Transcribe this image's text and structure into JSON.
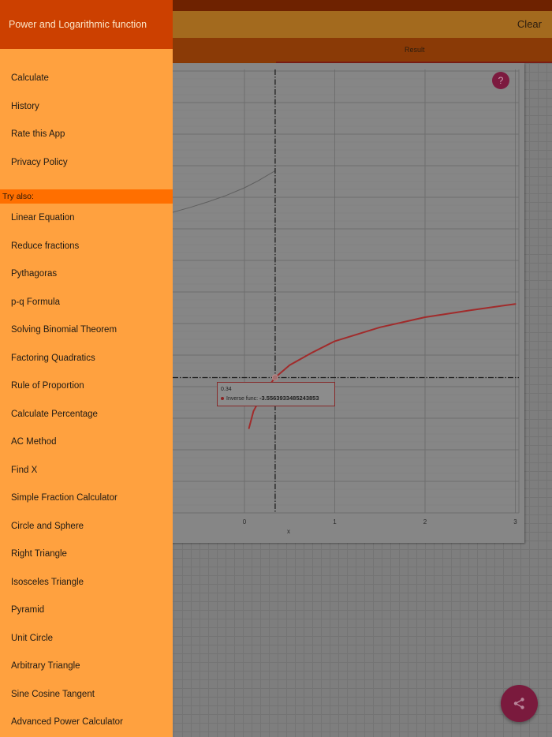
{
  "app": {
    "title": "Power and Logarithmic function",
    "clear_label": "Clear",
    "result_tab": "Result",
    "help_label": "?"
  },
  "drawer": {
    "items": [
      "Calculate",
      "History",
      "Rate this App",
      "Privacy Policy"
    ],
    "section_label": "Try also:",
    "try_also": [
      "Linear Equation",
      "Reduce fractions",
      "Pythagoras",
      "p-q Formula",
      "Solving Binomial Theorem",
      "Factoring Quadratics",
      "Rule of Proportion",
      "Calculate Percentage",
      "AC Method",
      "Find X",
      "Simple Fraction Calculator",
      "Circle and Sphere",
      "Right Triangle",
      "Isosceles Triangle",
      "Pyramid",
      "Unit Circle",
      "Arbitrary Triangle",
      "Sine Cosine Tangent",
      "Advanced Power Calculator"
    ]
  },
  "tooltip": {
    "x": "0.34",
    "series": "Inverse func:",
    "value": "-3.5563933485243853"
  },
  "colors": {
    "drawer_bg": "#ffa13f",
    "drawer_header": "#cc4000",
    "section_header": "#ff6f00",
    "inverse_line": "#a12b2b",
    "accent_fab": "#7a1a3d"
  },
  "icons": {
    "share": "share-icon",
    "help": "question-icon"
  },
  "chart_data": {
    "type": "line",
    "xlabel": "x",
    "x_ticks": [
      "0",
      "1",
      "2",
      "3"
    ],
    "xlim": [
      -0.8,
      3
    ],
    "crosshair_x": 0.34,
    "series": [
      {
        "name": "Inverse func",
        "x": [
          0.05,
          0.1,
          0.2,
          0.34,
          0.5,
          0.75,
          1,
          1.5,
          2,
          2.5,
          3
        ],
        "y": [
          -11.6,
          -8.9,
          -6.2,
          -3.56,
          -1.6,
          0.4,
          2.2,
          4.4,
          6.0,
          7.1,
          8.1
        ]
      },
      {
        "name": "",
        "x": [
          -0.8,
          -0.6,
          -0.4,
          -0.2,
          0,
          0.15,
          0.34
        ],
        "y": [
          22.6,
          23.4,
          24.3,
          25.3,
          26.5,
          27.6,
          29.2
        ]
      }
    ]
  }
}
